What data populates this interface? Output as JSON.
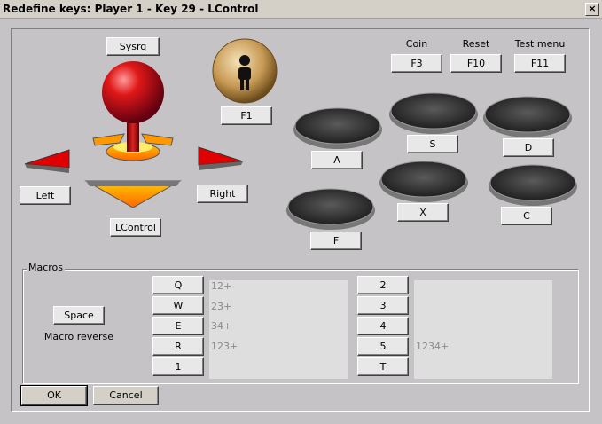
{
  "window": {
    "title": "Redefine keys: Player 1 - Key 29 - LControl",
    "close_label": "×"
  },
  "joystick": {
    "sysrq": "Sysrq",
    "start": "F1",
    "left": "Left",
    "right": "Right",
    "down": "LControl"
  },
  "system": {
    "coin_label": "Coin",
    "coin_key": "F3",
    "reset_label": "Reset",
    "reset_key": "F10",
    "test_label": "Test menu",
    "test_key": "F11"
  },
  "buttons": {
    "a": "A",
    "s": "S",
    "d": "D",
    "x": "X",
    "c": "C",
    "f": "F"
  },
  "macros": {
    "title": "Macros",
    "space_key": "Space",
    "reverse_label": "Macro reverse",
    "left_keys": [
      "Q",
      "W",
      "E",
      "R",
      "1"
    ],
    "left_values": [
      "12+",
      "23+",
      "34+",
      "123+"
    ],
    "right_keys": [
      "2",
      "3",
      "4",
      "5",
      "T"
    ],
    "right_values": [
      "1234+"
    ]
  },
  "dialog": {
    "ok": "OK",
    "cancel": "Cancel"
  },
  "colors": {
    "ball": "#d01818",
    "arrow": "#e00000",
    "base": "#ff9900",
    "start_bg": "#c8a060"
  }
}
